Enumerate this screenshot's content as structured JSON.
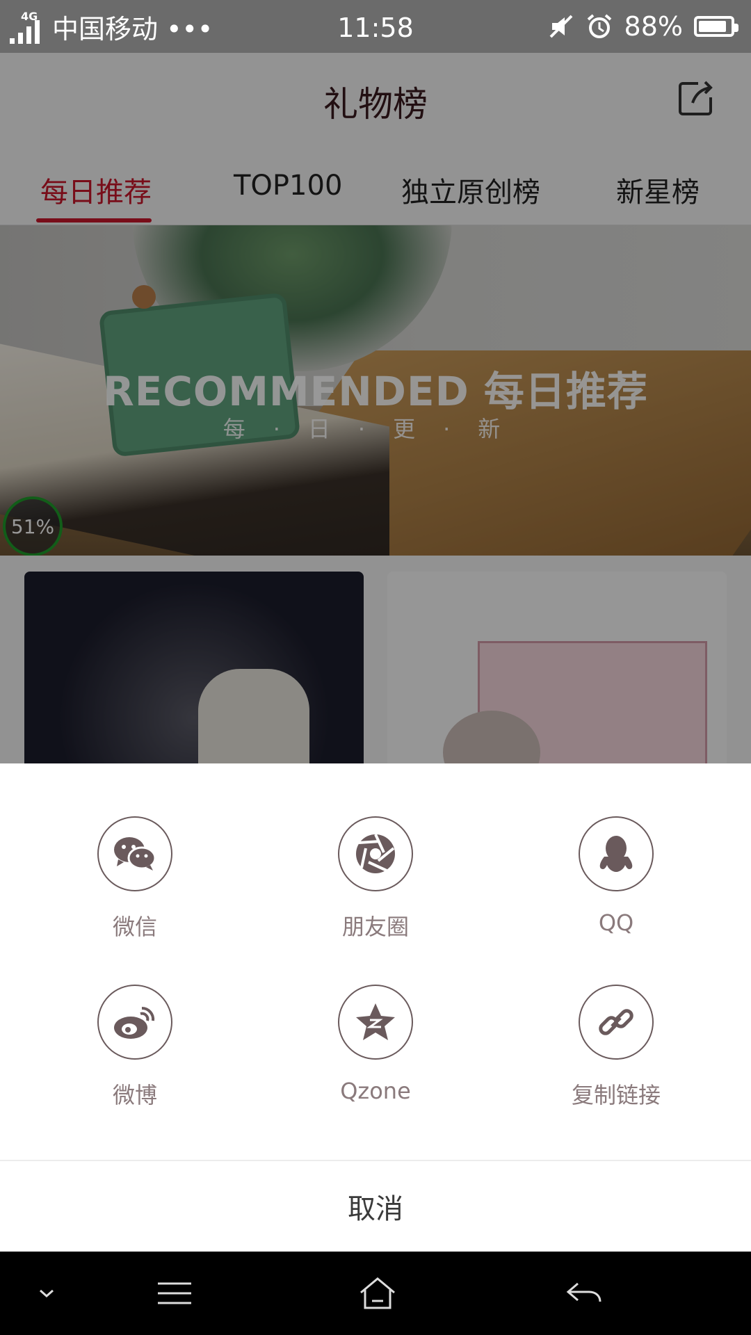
{
  "status_bar": {
    "network": "4G",
    "carrier": "中国移动 •••",
    "time": "11:58",
    "battery_percent": "88%",
    "battery_level": 0.88
  },
  "header": {
    "title": "礼物榜",
    "share_icon": "share-icon"
  },
  "tabs": [
    {
      "label": "每日推荐",
      "active": true
    },
    {
      "label": "TOP100",
      "active": false
    },
    {
      "label": "独立原创榜",
      "active": false
    },
    {
      "label": "新星榜",
      "active": false
    }
  ],
  "banner": {
    "title": "RECOMMENDED  每日推荐",
    "subtitle": "每·日·更·新"
  },
  "floating_badge": {
    "text": "51%"
  },
  "share_sheet": {
    "items": [
      {
        "label": "微信",
        "icon": "wechat-icon"
      },
      {
        "label": "朋友圈",
        "icon": "moments-icon"
      },
      {
        "label": "QQ",
        "icon": "qq-icon"
      },
      {
        "label": "微博",
        "icon": "weibo-icon"
      },
      {
        "label": "Qzone",
        "icon": "qzone-icon"
      },
      {
        "label": "复制链接",
        "icon": "link-icon"
      }
    ],
    "cancel_label": "取消"
  },
  "colors": {
    "accent": "#c9162b",
    "icon_stroke": "#6a5a5c",
    "label": "#8a7a7c"
  }
}
